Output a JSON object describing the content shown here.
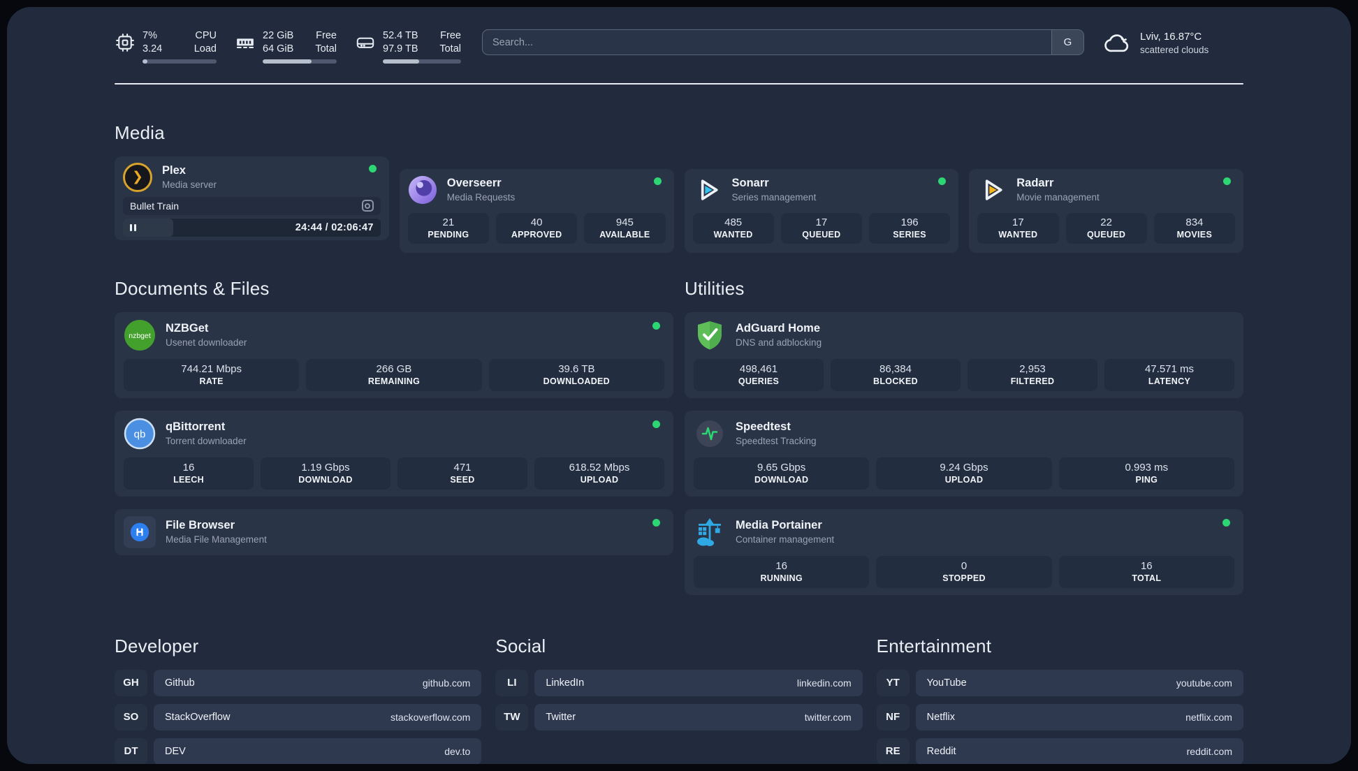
{
  "colors": {
    "status_online": "#2bd673",
    "plex_accent": "#eca827",
    "overseerr_accent": "#7b5ddb",
    "sonarr_accent": "#36c3f2",
    "radarr_accent": "#f7b31a",
    "nzbget_accent": "#43a02c",
    "qbittorrent_accent": "#4a8fe2",
    "filebrowser_accent": "#2d7ff0",
    "adguard_accent": "#5fbe58",
    "speedtest_accent": "#2bd673",
    "portainer_accent": "#2ea9e4"
  },
  "header": {
    "metrics": [
      {
        "icon": "cpu-icon",
        "values": [
          "7%",
          "3.24"
        ],
        "labels": [
          "CPU",
          "Load"
        ],
        "progress_pct": 7
      },
      {
        "icon": "ram-icon",
        "values": [
          "22 GiB",
          "64 GiB"
        ],
        "labels": [
          "Free",
          "Total"
        ],
        "progress_pct": 66
      },
      {
        "icon": "disk-icon",
        "values": [
          "52.4 TB",
          "97.9 TB"
        ],
        "labels": [
          "Free",
          "Total"
        ],
        "progress_pct": 46
      }
    ],
    "search": {
      "placeholder": "Search...",
      "engine_button": "G"
    },
    "weather": {
      "icon": "cloud-icon",
      "location_temp": "Lviv, 16.87°C",
      "condition": "scattered clouds"
    }
  },
  "sections": {
    "media": {
      "title": "Media",
      "apps": [
        {
          "name": "Plex",
          "subtitle": "Media server",
          "online": true,
          "now_playing": "Bullet Train",
          "time": "24:44 / 02:06:47",
          "progress_pct": 19.5
        },
        {
          "name": "Overseerr",
          "subtitle": "Media Requests",
          "online": true,
          "stats": [
            {
              "value": "21",
              "label": "PENDING"
            },
            {
              "value": "40",
              "label": "APPROVED"
            },
            {
              "value": "945",
              "label": "AVAILABLE"
            }
          ]
        },
        {
          "name": "Sonarr",
          "subtitle": "Series management",
          "online": true,
          "stats": [
            {
              "value": "485",
              "label": "WANTED"
            },
            {
              "value": "17",
              "label": "QUEUED"
            },
            {
              "value": "196",
              "label": "SERIES"
            }
          ]
        },
        {
          "name": "Radarr",
          "subtitle": "Movie management",
          "online": true,
          "stats": [
            {
              "value": "17",
              "label": "WANTED"
            },
            {
              "value": "22",
              "label": "QUEUED"
            },
            {
              "value": "834",
              "label": "MOVIES"
            }
          ]
        }
      ]
    },
    "documents": {
      "title": "Documents & Files",
      "apps": [
        {
          "name": "NZBGet",
          "subtitle": "Usenet downloader",
          "online": true,
          "stats": [
            {
              "value": "744.21 Mbps",
              "label": "RATE"
            },
            {
              "value": "266 GB",
              "label": "REMAINING"
            },
            {
              "value": "39.6 TB",
              "label": "DOWNLOADED"
            }
          ]
        },
        {
          "name": "qBittorrent",
          "subtitle": "Torrent downloader",
          "online": true,
          "stats": [
            {
              "value": "16",
              "label": "LEECH"
            },
            {
              "value": "1.19 Gbps",
              "label": "DOWNLOAD"
            },
            {
              "value": "471",
              "label": "SEED"
            },
            {
              "value": "618.52 Mbps",
              "label": "UPLOAD"
            }
          ]
        },
        {
          "name": "File Browser",
          "subtitle": "Media File Management",
          "online": true,
          "stats": []
        }
      ]
    },
    "utilities": {
      "title": "Utilities",
      "apps": [
        {
          "name": "AdGuard Home",
          "subtitle": "DNS and adblocking",
          "online": false,
          "stats": [
            {
              "value": "498,461",
              "label": "QUERIES"
            },
            {
              "value": "86,384",
              "label": "BLOCKED"
            },
            {
              "value": "2,953",
              "label": "FILTERED"
            },
            {
              "value": "47.571 ms",
              "label": "LATENCY"
            }
          ]
        },
        {
          "name": "Speedtest",
          "subtitle": "Speedtest Tracking",
          "online": false,
          "stats": [
            {
              "value": "9.65 Gbps",
              "label": "DOWNLOAD"
            },
            {
              "value": "9.24 Gbps",
              "label": "UPLOAD"
            },
            {
              "value": "0.993 ms",
              "label": "PING"
            }
          ]
        },
        {
          "name": "Media Portainer",
          "subtitle": "Container management",
          "online": true,
          "stats": [
            {
              "value": "16",
              "label": "RUNNING"
            },
            {
              "value": "0",
              "label": "STOPPED"
            },
            {
              "value": "16",
              "label": "TOTAL"
            }
          ]
        }
      ]
    }
  },
  "bookmarks": {
    "groups": [
      {
        "title": "Developer",
        "items": [
          {
            "tag": "GH",
            "name": "Github",
            "url": "github.com"
          },
          {
            "tag": "SO",
            "name": "StackOverflow",
            "url": "stackoverflow.com"
          },
          {
            "tag": "DT",
            "name": "DEV",
            "url": "dev.to"
          }
        ]
      },
      {
        "title": "Social",
        "items": [
          {
            "tag": "LI",
            "name": "LinkedIn",
            "url": "linkedin.com"
          },
          {
            "tag": "TW",
            "name": "Twitter",
            "url": "twitter.com"
          }
        ]
      },
      {
        "title": "Entertainment",
        "items": [
          {
            "tag": "YT",
            "name": "YouTube",
            "url": "youtube.com"
          },
          {
            "tag": "NF",
            "name": "Netflix",
            "url": "netflix.com"
          },
          {
            "tag": "RE",
            "name": "Reddit",
            "url": "reddit.com"
          }
        ]
      }
    ]
  }
}
